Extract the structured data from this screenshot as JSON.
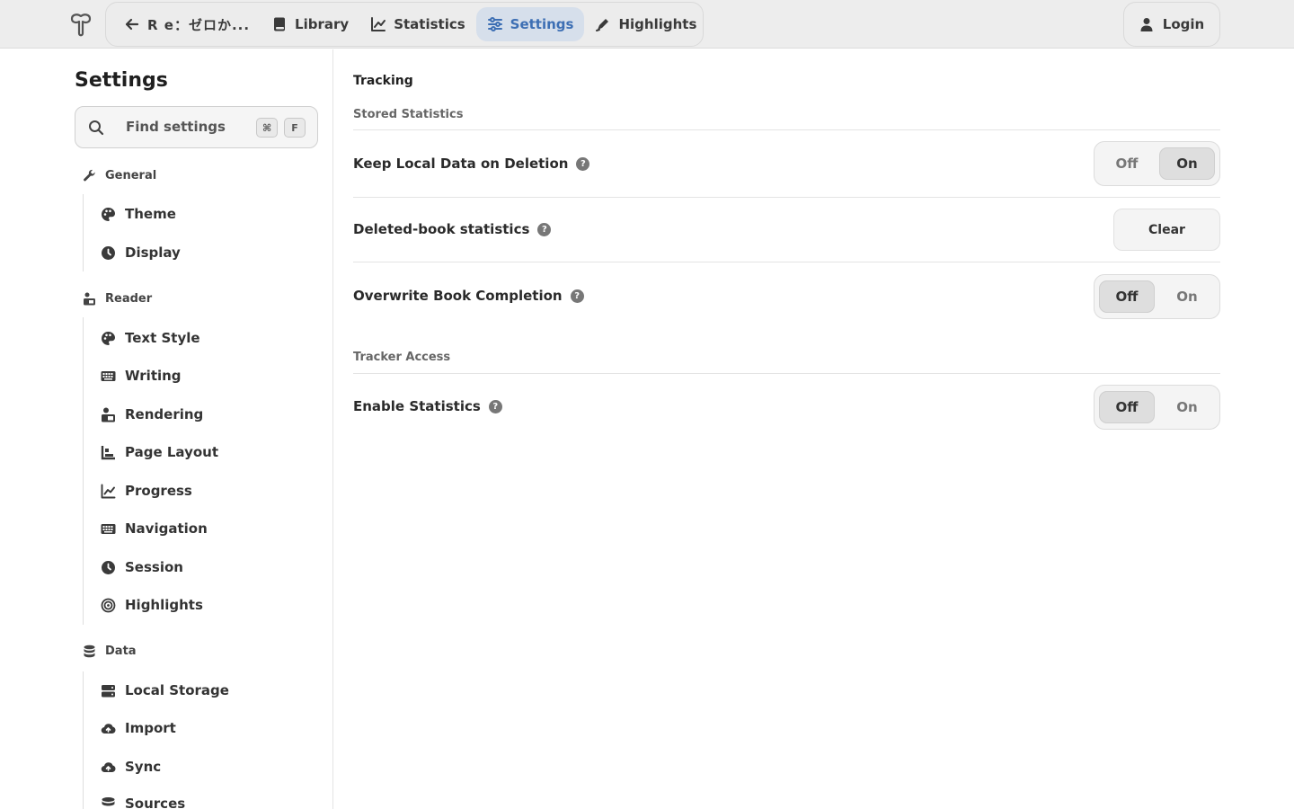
{
  "topbar": {
    "back_label": "R e：ゼロか...",
    "nav": [
      {
        "label": "Library",
        "icon": "book-icon"
      },
      {
        "label": "Statistics",
        "icon": "chart-line-icon"
      },
      {
        "label": "Settings",
        "icon": "sliders-icon",
        "active": true
      },
      {
        "label": "Highlights",
        "icon": "pen-icon"
      }
    ],
    "login_label": "Login",
    "accent": "#3d6fb4"
  },
  "sidebar": {
    "title": "Settings",
    "search_placeholder": "Find settings",
    "shortcut_keys": [
      "⌘",
      "F"
    ],
    "groups": [
      {
        "label": "General",
        "icon": "wrench-icon",
        "items": [
          {
            "label": "Theme",
            "icon": "palette-icon"
          },
          {
            "label": "Display",
            "icon": "clock-icon"
          }
        ]
      },
      {
        "label": "Reader",
        "icon": "reader-icon",
        "items": [
          {
            "label": "Text Style",
            "icon": "palette-icon"
          },
          {
            "label": "Writing",
            "icon": "keyboard-icon"
          },
          {
            "label": "Rendering",
            "icon": "reader-icon"
          },
          {
            "label": "Page Layout",
            "icon": "layout-icon"
          },
          {
            "label": "Progress",
            "icon": "chart-line-icon"
          },
          {
            "label": "Navigation",
            "icon": "keyboard-icon"
          },
          {
            "label": "Session",
            "icon": "clock-icon"
          },
          {
            "label": "Highlights",
            "icon": "target-icon"
          }
        ]
      },
      {
        "label": "Data",
        "icon": "database-icon",
        "items": [
          {
            "label": "Local Storage",
            "icon": "storage-icon"
          },
          {
            "label": "Import",
            "icon": "cloud-upload-icon"
          },
          {
            "label": "Sync",
            "icon": "cloud-upload-icon"
          },
          {
            "label": "Sources",
            "icon": "database-icon"
          }
        ]
      }
    ]
  },
  "main": {
    "section_title": "Tracking",
    "subsections": [
      {
        "title": "Stored Statistics",
        "rows": [
          {
            "label": "Keep Local Data on Deletion",
            "type": "toggle",
            "off_label": "Off",
            "on_label": "On",
            "value": "On"
          },
          {
            "label": "Deleted-book statistics",
            "type": "button",
            "button_label": "Clear"
          },
          {
            "label": "Overwrite Book Completion",
            "type": "toggle",
            "off_label": "Off",
            "on_label": "On",
            "value": "Off"
          }
        ]
      },
      {
        "title": "Tracker Access",
        "rows": [
          {
            "label": "Enable Statistics",
            "type": "toggle",
            "off_label": "Off",
            "on_label": "On",
            "value": "Off"
          }
        ]
      }
    ],
    "help_glyph": "?"
  }
}
